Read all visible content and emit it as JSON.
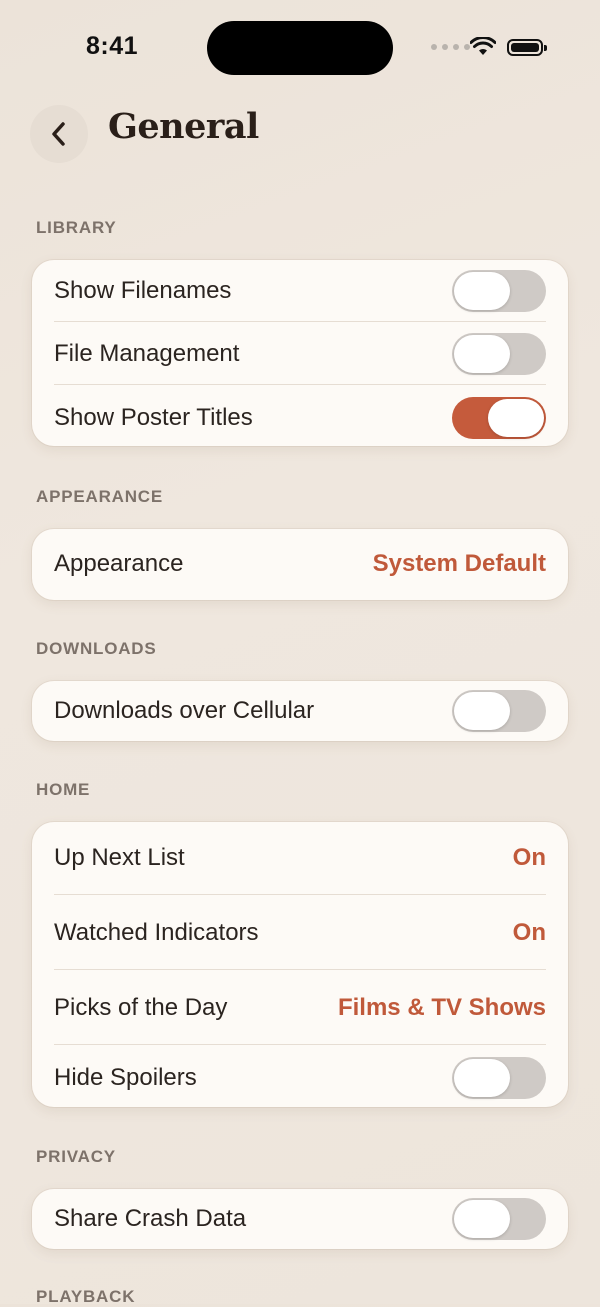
{
  "status_bar": {
    "time": "8:41"
  },
  "header": {
    "title": "General"
  },
  "sections": {
    "library": {
      "label": "LIBRARY",
      "rows": [
        {
          "label": "Show Filenames",
          "toggle_on": false
        },
        {
          "label": "File Management",
          "toggle_on": false
        },
        {
          "label": "Show Poster Titles",
          "toggle_on": true
        }
      ]
    },
    "appearance": {
      "label": "APPEARANCE",
      "rows": [
        {
          "label": "Appearance",
          "value": "System Default"
        }
      ]
    },
    "downloads": {
      "label": "DOWNLOADS",
      "rows": [
        {
          "label": "Downloads over Cellular",
          "toggle_on": false
        }
      ]
    },
    "home": {
      "label": "HOME",
      "rows": [
        {
          "label": "Up Next List",
          "value": "On"
        },
        {
          "label": "Watched Indicators",
          "value": "On"
        },
        {
          "label": "Picks of the Day",
          "value": "Films & TV Shows"
        },
        {
          "label": "Hide Spoilers",
          "toggle_on": false
        }
      ]
    },
    "privacy": {
      "label": "PRIVACY",
      "rows": [
        {
          "label": "Share Crash Data",
          "toggle_on": false
        }
      ]
    },
    "playback": {
      "label": "PLAYBACK"
    }
  },
  "colors": {
    "accent": "#c55b3c",
    "background": "#ede5dc",
    "card": "#fdfaf6"
  }
}
